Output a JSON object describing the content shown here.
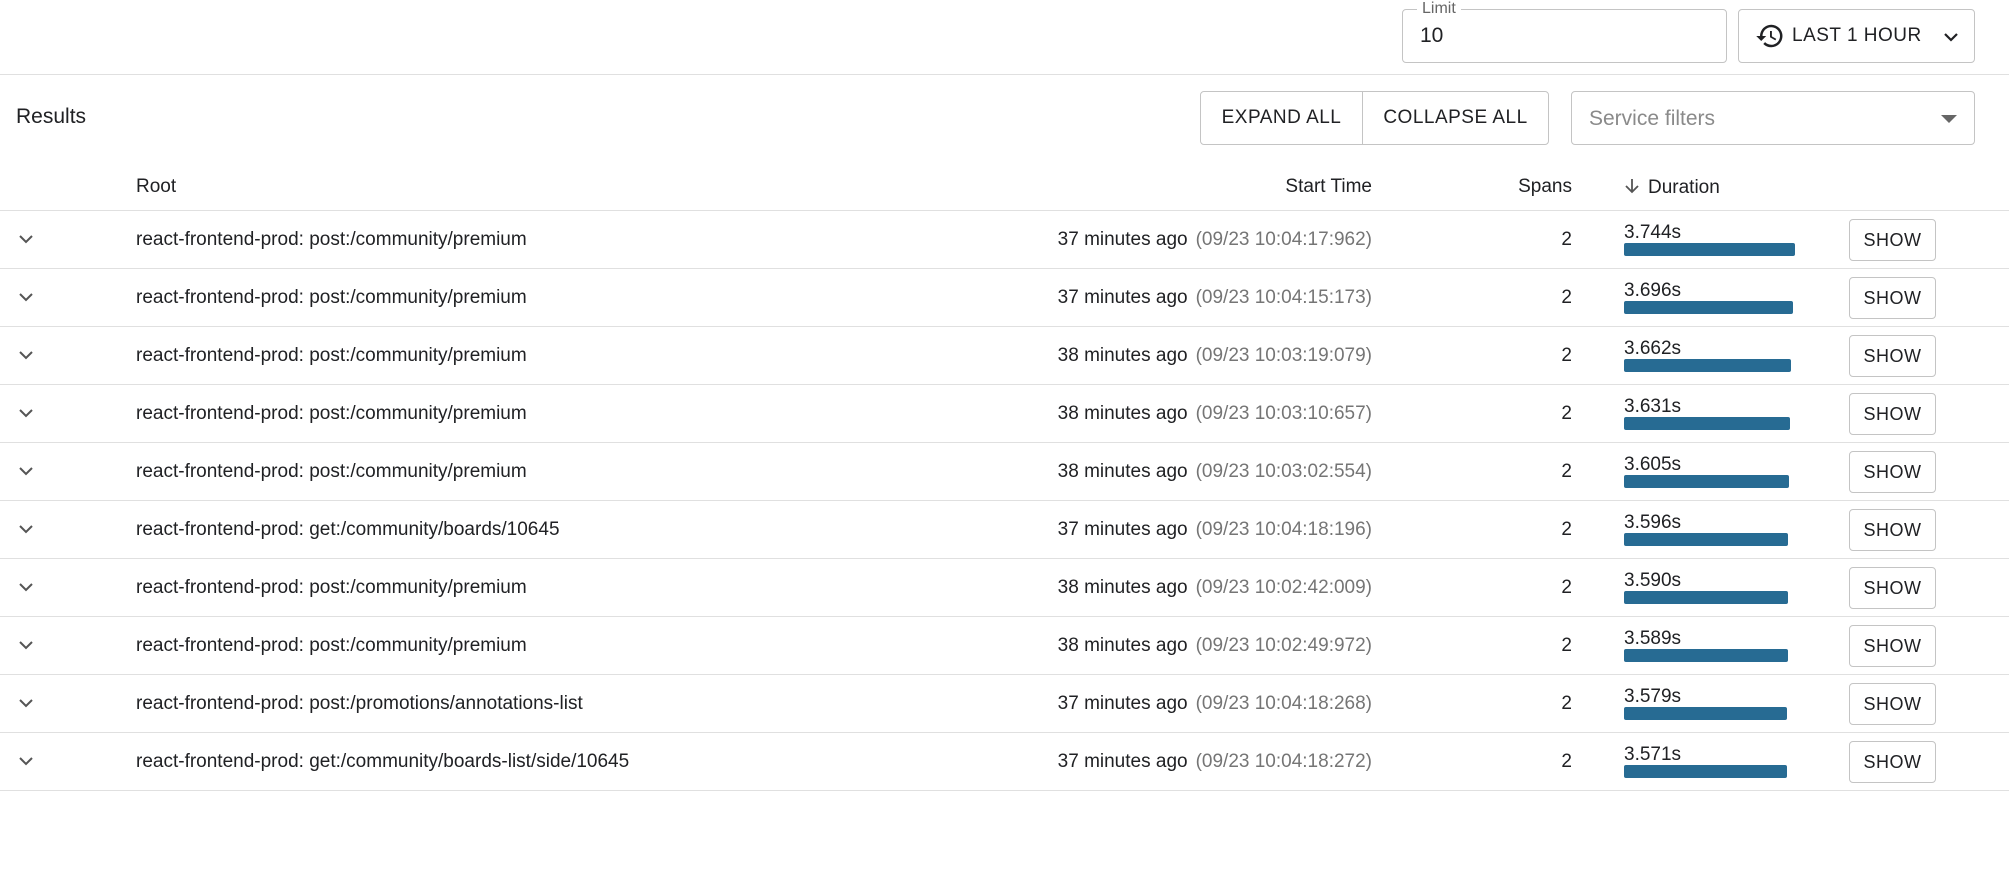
{
  "toolbar": {
    "limit_label": "Limit",
    "limit_value": "10",
    "time_range_label": "LAST 1 HOUR"
  },
  "results": {
    "title": "Results",
    "expand_all_label": "EXPAND ALL",
    "collapse_all_label": "COLLAPSE ALL",
    "service_filter_placeholder": "Service filters"
  },
  "columns": {
    "root": "Root",
    "start_time": "Start Time",
    "spans": "Spans",
    "duration": "Duration"
  },
  "row_action_label": "SHOW",
  "traces": [
    {
      "root": "react-frontend-prod: post:/community/premium",
      "relative": "37 minutes ago",
      "absolute": "(09/23 10:04:17:962)",
      "spans": "2",
      "duration": "3.744s",
      "duration_fraction": 1.0
    },
    {
      "root": "react-frontend-prod: post:/community/premium",
      "relative": "37 minutes ago",
      "absolute": "(09/23 10:04:15:173)",
      "spans": "2",
      "duration": "3.696s",
      "duration_fraction": 0.987
    },
    {
      "root": "react-frontend-prod: post:/community/premium",
      "relative": "38 minutes ago",
      "absolute": "(09/23 10:03:19:079)",
      "spans": "2",
      "duration": "3.662s",
      "duration_fraction": 0.978
    },
    {
      "root": "react-frontend-prod: post:/community/premium",
      "relative": "38 minutes ago",
      "absolute": "(09/23 10:03:10:657)",
      "spans": "2",
      "duration": "3.631s",
      "duration_fraction": 0.97
    },
    {
      "root": "react-frontend-prod: post:/community/premium",
      "relative": "38 minutes ago",
      "absolute": "(09/23 10:03:02:554)",
      "spans": "2",
      "duration": "3.605s",
      "duration_fraction": 0.963
    },
    {
      "root": "react-frontend-prod: get:/community/boards/10645",
      "relative": "37 minutes ago",
      "absolute": "(09/23 10:04:18:196)",
      "spans": "2",
      "duration": "3.596s",
      "duration_fraction": 0.96
    },
    {
      "root": "react-frontend-prod: post:/community/premium",
      "relative": "38 minutes ago",
      "absolute": "(09/23 10:02:42:009)",
      "spans": "2",
      "duration": "3.590s",
      "duration_fraction": 0.959
    },
    {
      "root": "react-frontend-prod: post:/community/premium",
      "relative": "38 minutes ago",
      "absolute": "(09/23 10:02:49:972)",
      "spans": "2",
      "duration": "3.589s",
      "duration_fraction": 0.959
    },
    {
      "root": "react-frontend-prod: post:/promotions/annotations-list",
      "relative": "37 minutes ago",
      "absolute": "(09/23 10:04:18:268)",
      "spans": "2",
      "duration": "3.579s",
      "duration_fraction": 0.956
    },
    {
      "root": "react-frontend-prod: get:/community/boards-list/side/10645",
      "relative": "37 minutes ago",
      "absolute": "(09/23 10:04:18:272)",
      "spans": "2",
      "duration": "3.571s",
      "duration_fraction": 0.954
    }
  ],
  "colors": {
    "duration_bar": "#276b93",
    "border": "#c4c4c4",
    "muted_text": "#757575"
  },
  "icons": {
    "time_range": "history-icon",
    "time_range_dropdown": "chevron-down-icon",
    "service_filter_dropdown": "caret-down-icon",
    "sort": "arrow-down-icon",
    "row_expand": "chevron-down-icon"
  }
}
